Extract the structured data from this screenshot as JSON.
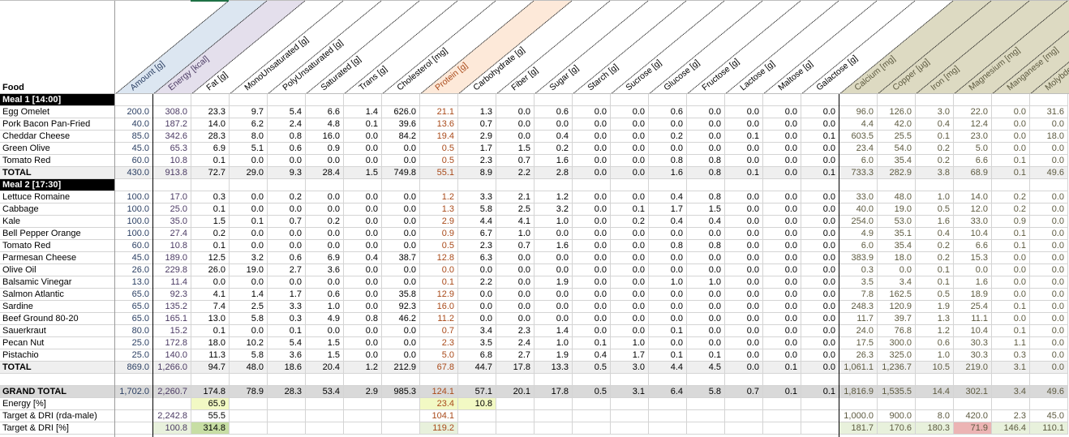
{
  "header": {
    "food_label": "Food",
    "columns": [
      {
        "key": "amount",
        "label": "Amount [g]",
        "group": "amount"
      },
      {
        "key": "energy",
        "label": "Energy [kcal]",
        "group": "energy"
      },
      {
        "key": "fat",
        "label": "Fat [g]",
        "group": "plain"
      },
      {
        "key": "mono",
        "label": "MonoUnsaturated [g]",
        "group": "plain"
      },
      {
        "key": "poly",
        "label": "PolyUnsaturated [g]",
        "group": "plain"
      },
      {
        "key": "sat",
        "label": "Saturated [g]",
        "group": "plain"
      },
      {
        "key": "trans",
        "label": "Trans [g]",
        "group": "plain"
      },
      {
        "key": "chol",
        "label": "Cholesterol [mg]",
        "group": "plain"
      },
      {
        "key": "protein",
        "label": "Protein [g]",
        "group": "protein"
      },
      {
        "key": "carb",
        "label": "Carbohydrate [g]",
        "group": "plain"
      },
      {
        "key": "fiber",
        "label": "Fiber [g]",
        "group": "plain"
      },
      {
        "key": "sugar",
        "label": "Sugar [g]",
        "group": "plain"
      },
      {
        "key": "starch",
        "label": "Starch [g]",
        "group": "plain"
      },
      {
        "key": "sucrose",
        "label": "Sucrose [g]",
        "group": "plain"
      },
      {
        "key": "glucose",
        "label": "Glucose [g]",
        "group": "plain"
      },
      {
        "key": "fructose",
        "label": "Fructose [g]",
        "group": "plain"
      },
      {
        "key": "lactose",
        "label": "Lactose [g]",
        "group": "plain"
      },
      {
        "key": "maltose",
        "label": "Maltose [g]",
        "group": "plain"
      },
      {
        "key": "galactose",
        "label": "Galactose [g]",
        "group": "plain"
      },
      {
        "key": "calcium",
        "label": "Calcium [mg]",
        "group": "mineral"
      },
      {
        "key": "copper",
        "label": "Copper [µg]",
        "group": "mineral"
      },
      {
        "key": "iron",
        "label": "Iron [mg]",
        "group": "mineral"
      },
      {
        "key": "magnesium",
        "label": "Magnesium [mg]",
        "group": "mineral"
      },
      {
        "key": "manganese",
        "label": "Manganese [mg]",
        "group": "mineral"
      },
      {
        "key": "molybdenum",
        "label": "Molybdenum",
        "group": "mineral"
      }
    ]
  },
  "colors": {
    "amount_bg": "#dce6f1",
    "energy_bg": "#e4dfec",
    "protein_bg": "#fde9d9",
    "mineral_bg": "#dddac2",
    "amount_text": "#2b3f63",
    "energy_text": "#4b3a63",
    "protein_text": "#a94a1a",
    "mineral_text": "#5d5a40"
  },
  "meals": [
    {
      "title": "Meal 1 [14:00]",
      "items": [
        {
          "name": "Egg Omelet",
          "values": [
            "200.0",
            "308.0",
            "23.3",
            "9.7",
            "5.4",
            "6.6",
            "1.4",
            "626.0",
            "21.1",
            "1.3",
            "0.0",
            "0.6",
            "0.0",
            "0.0",
            "0.6",
            "0.0",
            "0.0",
            "0.0",
            "0.0",
            "96.0",
            "126.0",
            "3.0",
            "22.0",
            "0.0",
            "31.6"
          ]
        },
        {
          "name": "Pork Bacon Pan-Fried",
          "values": [
            "40.0",
            "187.2",
            "14.0",
            "6.2",
            "2.4",
            "4.8",
            "0.1",
            "39.6",
            "13.6",
            "0.7",
            "0.0",
            "0.0",
            "0.0",
            "0.0",
            "0.0",
            "0.0",
            "0.0",
            "0.0",
            "0.0",
            "4.4",
            "42.0",
            "0.4",
            "12.4",
            "0.0",
            "0.0"
          ]
        },
        {
          "name": "Cheddar Cheese",
          "values": [
            "85.0",
            "342.6",
            "28.3",
            "8.0",
            "0.8",
            "16.0",
            "0.0",
            "84.2",
            "19.4",
            "2.9",
            "0.0",
            "0.4",
            "0.0",
            "0.0",
            "0.2",
            "0.0",
            "0.1",
            "0.0",
            "0.1",
            "603.5",
            "25.5",
            "0.1",
            "23.0",
            "0.0",
            "18.0"
          ]
        },
        {
          "name": "Green Olive",
          "values": [
            "45.0",
            "65.3",
            "6.9",
            "5.1",
            "0.6",
            "0.9",
            "0.0",
            "0.0",
            "0.5",
            "1.7",
            "1.5",
            "0.2",
            "0.0",
            "0.0",
            "0.0",
            "0.0",
            "0.0",
            "0.0",
            "0.0",
            "23.4",
            "54.0",
            "0.2",
            "5.0",
            "0.0",
            "0.0"
          ]
        },
        {
          "name": "Tomato Red",
          "values": [
            "60.0",
            "10.8",
            "0.1",
            "0.0",
            "0.0",
            "0.0",
            "0.0",
            "0.0",
            "0.5",
            "2.3",
            "0.7",
            "1.6",
            "0.0",
            "0.0",
            "0.8",
            "0.8",
            "0.0",
            "0.0",
            "0.0",
            "6.0",
            "35.4",
            "0.2",
            "6.6",
            "0.1",
            "0.0"
          ]
        }
      ],
      "total": {
        "label": "TOTAL",
        "values": [
          "430.0",
          "913.8",
          "72.7",
          "29.0",
          "9.3",
          "28.4",
          "1.5",
          "749.8",
          "55.1",
          "8.9",
          "2.2",
          "2.8",
          "0.0",
          "0.0",
          "1.6",
          "0.8",
          "0.1",
          "0.0",
          "0.1",
          "733.3",
          "282.9",
          "3.8",
          "68.9",
          "0.1",
          "49.6"
        ]
      }
    },
    {
      "title": "Meal 2 [17:30]",
      "items": [
        {
          "name": "Lettuce Romaine",
          "values": [
            "100.0",
            "17.0",
            "0.3",
            "0.0",
            "0.2",
            "0.0",
            "0.0",
            "0.0",
            "1.2",
            "3.3",
            "2.1",
            "1.2",
            "0.0",
            "0.0",
            "0.4",
            "0.8",
            "0.0",
            "0.0",
            "0.0",
            "33.0",
            "48.0",
            "1.0",
            "14.0",
            "0.2",
            "0.0"
          ]
        },
        {
          "name": "Cabbage",
          "values": [
            "100.0",
            "25.0",
            "0.1",
            "0.0",
            "0.0",
            "0.0",
            "0.0",
            "0.0",
            "1.3",
            "5.8",
            "2.5",
            "3.2",
            "0.0",
            "0.1",
            "1.7",
            "1.5",
            "0.0",
            "0.0",
            "0.0",
            "40.0",
            "19.0",
            "0.5",
            "12.0",
            "0.2",
            "0.0"
          ]
        },
        {
          "name": "Kale",
          "values": [
            "100.0",
            "35.0",
            "1.5",
            "0.1",
            "0.7",
            "0.2",
            "0.0",
            "0.0",
            "2.9",
            "4.4",
            "4.1",
            "1.0",
            "0.0",
            "0.2",
            "0.4",
            "0.4",
            "0.0",
            "0.0",
            "0.0",
            "254.0",
            "53.0",
            "1.6",
            "33.0",
            "0.9",
            "0.0"
          ]
        },
        {
          "name": "Bell Pepper Orange",
          "values": [
            "100.0",
            "27.4",
            "0.2",
            "0.0",
            "0.0",
            "0.0",
            "0.0",
            "0.0",
            "0.9",
            "6.7",
            "1.0",
            "0.0",
            "0.0",
            "0.0",
            "0.0",
            "0.0",
            "0.0",
            "0.0",
            "0.0",
            "4.9",
            "35.1",
            "0.4",
            "10.4",
            "0.1",
            "0.0"
          ]
        },
        {
          "name": "Tomato Red",
          "values": [
            "60.0",
            "10.8",
            "0.1",
            "0.0",
            "0.0",
            "0.0",
            "0.0",
            "0.0",
            "0.5",
            "2.3",
            "0.7",
            "1.6",
            "0.0",
            "0.0",
            "0.8",
            "0.8",
            "0.0",
            "0.0",
            "0.0",
            "6.0",
            "35.4",
            "0.2",
            "6.6",
            "0.1",
            "0.0"
          ]
        },
        {
          "name": "Parmesan Cheese",
          "values": [
            "45.0",
            "189.0",
            "12.5",
            "3.2",
            "0.6",
            "6.9",
            "0.4",
            "38.7",
            "12.8",
            "6.3",
            "0.0",
            "0.0",
            "0.0",
            "0.0",
            "0.0",
            "0.0",
            "0.0",
            "0.0",
            "0.0",
            "383.9",
            "18.0",
            "0.2",
            "15.3",
            "0.0",
            "0.0"
          ]
        },
        {
          "name": "Olive Oil",
          "values": [
            "26.0",
            "229.8",
            "26.0",
            "19.0",
            "2.7",
            "3.6",
            "0.0",
            "0.0",
            "0.0",
            "0.0",
            "0.0",
            "0.0",
            "0.0",
            "0.0",
            "0.0",
            "0.0",
            "0.0",
            "0.0",
            "0.0",
            "0.3",
            "0.0",
            "0.1",
            "0.0",
            "0.0",
            "0.0"
          ]
        },
        {
          "name": "Balsamic Vinegar",
          "values": [
            "13.0",
            "11.4",
            "0.0",
            "0.0",
            "0.0",
            "0.0",
            "0.0",
            "0.0",
            "0.1",
            "2.2",
            "0.0",
            "1.9",
            "0.0",
            "0.0",
            "1.0",
            "1.0",
            "0.0",
            "0.0",
            "0.0",
            "3.5",
            "3.4",
            "0.1",
            "1.6",
            "0.0",
            "0.0"
          ]
        },
        {
          "name": "Salmon Atlantic",
          "values": [
            "65.0",
            "92.3",
            "4.1",
            "1.4",
            "1.7",
            "0.6",
            "0.0",
            "35.8",
            "12.9",
            "0.0",
            "0.0",
            "0.0",
            "0.0",
            "0.0",
            "0.0",
            "0.0",
            "0.0",
            "0.0",
            "0.0",
            "7.8",
            "162.5",
            "0.5",
            "18.9",
            "0.0",
            "0.0"
          ]
        },
        {
          "name": "Sardine",
          "values": [
            "65.0",
            "135.2",
            "7.4",
            "2.5",
            "3.3",
            "1.0",
            "0.0",
            "92.3",
            "16.0",
            "0.0",
            "0.0",
            "0.0",
            "0.0",
            "0.0",
            "0.0",
            "0.0",
            "0.0",
            "0.0",
            "0.0",
            "248.3",
            "120.9",
            "1.9",
            "25.4",
            "0.1",
            "0.0"
          ]
        },
        {
          "name": "Beef Ground 80-20",
          "values": [
            "65.0",
            "165.1",
            "13.0",
            "5.8",
            "0.3",
            "4.9",
            "0.8",
            "46.2",
            "11.2",
            "0.0",
            "0.0",
            "0.0",
            "0.0",
            "0.0",
            "0.0",
            "0.0",
            "0.0",
            "0.0",
            "0.0",
            "11.7",
            "39.7",
            "1.3",
            "11.1",
            "0.0",
            "0.0"
          ]
        },
        {
          "name": "Sauerkraut",
          "values": [
            "80.0",
            "15.2",
            "0.1",
            "0.0",
            "0.1",
            "0.0",
            "0.0",
            "0.0",
            "0.7",
            "3.4",
            "2.3",
            "1.4",
            "0.0",
            "0.0",
            "0.1",
            "0.0",
            "0.0",
            "0.0",
            "0.0",
            "24.0",
            "76.8",
            "1.2",
            "10.4",
            "0.1",
            "0.0"
          ]
        },
        {
          "name": "Pecan Nut",
          "values": [
            "25.0",
            "172.8",
            "18.0",
            "10.2",
            "5.4",
            "1.5",
            "0.0",
            "0.0",
            "2.3",
            "3.5",
            "2.4",
            "1.0",
            "0.1",
            "1.0",
            "0.0",
            "0.0",
            "0.0",
            "0.0",
            "0.0",
            "17.5",
            "300.0",
            "0.6",
            "30.3",
            "1.1",
            "0.0"
          ]
        },
        {
          "name": "Pistachio",
          "values": [
            "25.0",
            "140.0",
            "11.3",
            "5.8",
            "3.6",
            "1.5",
            "0.0",
            "0.0",
            "5.0",
            "6.8",
            "2.7",
            "1.9",
            "0.4",
            "1.7",
            "0.1",
            "0.1",
            "0.0",
            "0.0",
            "0.0",
            "26.3",
            "325.0",
            "1.0",
            "30.3",
            "0.3",
            "0.0"
          ]
        }
      ],
      "total": {
        "label": "TOTAL",
        "values": [
          "869.0",
          "1,266.0",
          "94.7",
          "48.0",
          "18.6",
          "20.4",
          "1.2",
          "212.9",
          "67.8",
          "44.7",
          "17.8",
          "13.3",
          "0.5",
          "3.0",
          "4.4",
          "4.5",
          "0.0",
          "0.1",
          "0.0",
          "1,061.1",
          "1,236.7",
          "10.5",
          "219.0",
          "3.1",
          "0.0"
        ]
      }
    }
  ],
  "grand_total": {
    "label": "GRAND TOTAL",
    "values": [
      "1,702.0",
      "2,260.7",
      "174.8",
      "78.9",
      "28.3",
      "53.4",
      "2.9",
      "985.3",
      "124.1",
      "57.1",
      "20.1",
      "17.8",
      "0.5",
      "3.1",
      "6.4",
      "5.8",
      "0.7",
      "0.1",
      "0.1",
      "1,816.9",
      "1,535.5",
      "14.4",
      "302.1",
      "3.4",
      "49.6"
    ]
  },
  "summary_rows": [
    {
      "label": "Energy [%]",
      "values": [
        "",
        "",
        "65.9",
        "",
        "",
        "",
        "",
        "",
        "23.4",
        "10.8",
        "",
        "",
        "",
        "",
        "",
        "",
        "",
        "",
        "",
        "",
        "",
        "",
        "",
        "",
        ""
      ],
      "highlight": [
        "",
        "",
        "yellow",
        "",
        "",
        "",
        "",
        "",
        "yellow",
        "yellow",
        "",
        "",
        "",
        "",
        "",
        "",
        "",
        "",
        "",
        "",
        "",
        "",
        "",
        "",
        ""
      ]
    },
    {
      "label": "Target & DRI (rda-male)",
      "values": [
        "",
        "2,242.8",
        "55.5",
        "",
        "",
        "",
        "",
        "",
        "104.1",
        "",
        "",
        "",
        "",
        "",
        "",
        "",
        "",
        "",
        "",
        "1,000.0",
        "900.0",
        "8.0",
        "420.0",
        "2.3",
        "45.0"
      ],
      "highlight": [
        "",
        "",
        "",
        "",
        "",
        "",
        "",
        "",
        "",
        "",
        "",
        "",
        "",
        "",
        "",
        "",
        "",
        "",
        "",
        "",
        "",
        "",
        "",
        "",
        ""
      ]
    },
    {
      "label": "Target & DRI [%]",
      "values": [
        "",
        "100.8",
        "314.8",
        "",
        "",
        "",
        "",
        "",
        "119.2",
        "",
        "",
        "",
        "",
        "",
        "",
        "",
        "",
        "",
        "",
        "181.7",
        "170.6",
        "180.3",
        "71.9",
        "146.4",
        "110.1"
      ],
      "highlight": [
        "",
        "lgreen",
        "green",
        "",
        "",
        "",
        "",
        "",
        "lgreen",
        "",
        "",
        "",
        "",
        "",
        "",
        "",
        "",
        "",
        "",
        "lgreen",
        "lgreen",
        "lgreen",
        "red",
        "lgreen",
        "lgreen"
      ]
    }
  ]
}
